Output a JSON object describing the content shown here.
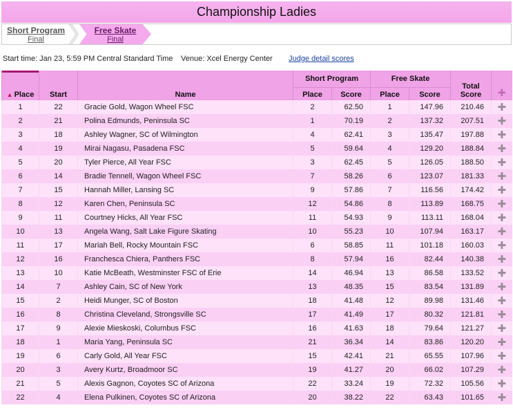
{
  "header": {
    "title": "Championship Ladies"
  },
  "tabs": [
    {
      "label": "Short Program",
      "sub": "Final"
    },
    {
      "label": "Free Skate",
      "sub": "Final"
    }
  ],
  "info": {
    "start_time": "Start time: Jan 23, 5:59 PM Central Standard Time",
    "venue": "Venue: Xcel Energy Center",
    "judge_link": "Judge detail scores"
  },
  "columns": {
    "place": "Place",
    "start": "Start",
    "name": "Name",
    "short_program": "Short Program",
    "free_skate": "Free Skate",
    "sp_place": "Place",
    "sp_score": "Score",
    "fs_place": "Place",
    "fs_score": "Score",
    "total_line1": "Total",
    "total_line2": "Score"
  },
  "icons": {
    "sort": "sort-up-icon",
    "expand": "plus-icon"
  },
  "colors": {
    "header_bg": "#f0a3e6",
    "title_bg": "#f3a6ea",
    "row_light": "#fde2f9",
    "row_dark": "#fbd0f5",
    "link": "#1a3fa0"
  },
  "rows": [
    {
      "place": "1",
      "start": "22",
      "name": "Gracie Gold, Wagon Wheel FSC",
      "sp_place": "2",
      "sp_score": "62.50",
      "fs_place": "1",
      "fs_score": "147.96",
      "total": "210.46"
    },
    {
      "place": "2",
      "start": "21",
      "name": "Polina Edmunds, Peninsula SC",
      "sp_place": "1",
      "sp_score": "70.19",
      "fs_place": "2",
      "fs_score": "137.32",
      "total": "207.51"
    },
    {
      "place": "3",
      "start": "18",
      "name": "Ashley Wagner, SC of Wilmington",
      "sp_place": "4",
      "sp_score": "62.41",
      "fs_place": "3",
      "fs_score": "135.47",
      "total": "197.88"
    },
    {
      "place": "4",
      "start": "19",
      "name": "Mirai Nagasu, Pasadena FSC",
      "sp_place": "5",
      "sp_score": "59.64",
      "fs_place": "4",
      "fs_score": "129.20",
      "total": "188.84"
    },
    {
      "place": "5",
      "start": "20",
      "name": "Tyler Pierce, All Year FSC",
      "sp_place": "3",
      "sp_score": "62.45",
      "fs_place": "5",
      "fs_score": "126.05",
      "total": "188.50"
    },
    {
      "place": "6",
      "start": "14",
      "name": "Bradie Tennell, Wagon Wheel FSC",
      "sp_place": "7",
      "sp_score": "58.26",
      "fs_place": "6",
      "fs_score": "123.07",
      "total": "181.33"
    },
    {
      "place": "7",
      "start": "15",
      "name": "Hannah Miller, Lansing SC",
      "sp_place": "9",
      "sp_score": "57.86",
      "fs_place": "7",
      "fs_score": "116.56",
      "total": "174.42"
    },
    {
      "place": "8",
      "start": "12",
      "name": "Karen Chen, Peninsula SC",
      "sp_place": "12",
      "sp_score": "54.86",
      "fs_place": "8",
      "fs_score": "113.89",
      "total": "168.75"
    },
    {
      "place": "9",
      "start": "11",
      "name": "Courtney Hicks, All Year FSC",
      "sp_place": "11",
      "sp_score": "54.93",
      "fs_place": "9",
      "fs_score": "113.11",
      "total": "168.04"
    },
    {
      "place": "10",
      "start": "13",
      "name": "Angela Wang, Salt Lake Figure Skating",
      "sp_place": "10",
      "sp_score": "55.23",
      "fs_place": "10",
      "fs_score": "107.94",
      "total": "163.17"
    },
    {
      "place": "11",
      "start": "17",
      "name": "Mariah Bell, Rocky Mountain FSC",
      "sp_place": "6",
      "sp_score": "58.85",
      "fs_place": "11",
      "fs_score": "101.18",
      "total": "160.03"
    },
    {
      "place": "12",
      "start": "16",
      "name": "Franchesca Chiera, Panthers FSC",
      "sp_place": "8",
      "sp_score": "57.94",
      "fs_place": "16",
      "fs_score": "82.44",
      "total": "140.38"
    },
    {
      "place": "13",
      "start": "10",
      "name": "Katie McBeath, Westminster FSC of Erie",
      "sp_place": "14",
      "sp_score": "46.94",
      "fs_place": "13",
      "fs_score": "86.58",
      "total": "133.52"
    },
    {
      "place": "14",
      "start": "7",
      "name": "Ashley Cain, SC of New York",
      "sp_place": "13",
      "sp_score": "48.35",
      "fs_place": "15",
      "fs_score": "83.54",
      "total": "131.89"
    },
    {
      "place": "15",
      "start": "2",
      "name": "Heidi Munger, SC of Boston",
      "sp_place": "18",
      "sp_score": "41.48",
      "fs_place": "12",
      "fs_score": "89.98",
      "total": "131.46"
    },
    {
      "place": "16",
      "start": "8",
      "name": "Christina Cleveland, Strongsville SC",
      "sp_place": "17",
      "sp_score": "41.49",
      "fs_place": "17",
      "fs_score": "80.32",
      "total": "121.81"
    },
    {
      "place": "17",
      "start": "9",
      "name": "Alexie Mieskoski, Columbus FSC",
      "sp_place": "16",
      "sp_score": "41.63",
      "fs_place": "18",
      "fs_score": "79.64",
      "total": "121.27"
    },
    {
      "place": "18",
      "start": "1",
      "name": "Maria Yang, Peninsula SC",
      "sp_place": "21",
      "sp_score": "36.34",
      "fs_place": "14",
      "fs_score": "83.86",
      "total": "120.20"
    },
    {
      "place": "19",
      "start": "6",
      "name": "Carly Gold, All Year FSC",
      "sp_place": "15",
      "sp_score": "42.41",
      "fs_place": "21",
      "fs_score": "65.55",
      "total": "107.96"
    },
    {
      "place": "20",
      "start": "3",
      "name": "Avery Kurtz, Broadmoor SC",
      "sp_place": "19",
      "sp_score": "41.27",
      "fs_place": "20",
      "fs_score": "66.02",
      "total": "107.29"
    },
    {
      "place": "21",
      "start": "5",
      "name": "Alexis Gagnon, Coyotes SC of Arizona",
      "sp_place": "22",
      "sp_score": "33.24",
      "fs_place": "19",
      "fs_score": "72.32",
      "total": "105.56"
    },
    {
      "place": "22",
      "start": "4",
      "name": "Elena Pulkinen, Coyotes SC of Arizona",
      "sp_place": "20",
      "sp_score": "38.22",
      "fs_place": "22",
      "fs_score": "63.43",
      "total": "101.65"
    }
  ]
}
